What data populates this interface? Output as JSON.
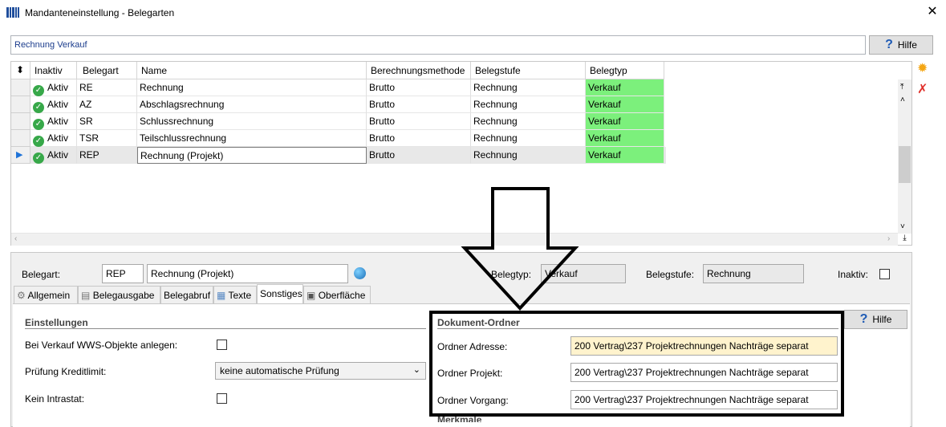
{
  "window": {
    "title": "Mandanteneinstellung - Belegarten",
    "close": "✕"
  },
  "filter": {
    "value": "Rechnung Verkauf"
  },
  "help": {
    "label": "Hilfe",
    "icon": "help-question-icon"
  },
  "grid": {
    "headers": [
      "Inaktiv",
      "Belegart",
      "Name",
      "Berechnungsmethode",
      "Belegstufe",
      "Belegtyp"
    ],
    "rows": [
      {
        "inaktiv": "Aktiv",
        "belegart": "RE",
        "name": "Rechnung",
        "methode": "Brutto",
        "stufe": "Rechnung",
        "typ": "Verkauf"
      },
      {
        "inaktiv": "Aktiv",
        "belegart": "AZ",
        "name": "Abschlagsrechnung",
        "methode": "Brutto",
        "stufe": "Rechnung",
        "typ": "Verkauf"
      },
      {
        "inaktiv": "Aktiv",
        "belegart": "SR",
        "name": "Schlussrechnung",
        "methode": "Brutto",
        "stufe": "Rechnung",
        "typ": "Verkauf"
      },
      {
        "inaktiv": "Aktiv",
        "belegart": "TSR",
        "name": "Teilschlussrechnung",
        "methode": "Brutto",
        "stufe": "Rechnung",
        "typ": "Verkauf"
      },
      {
        "inaktiv": "Aktiv",
        "belegart": "REP",
        "name": "Rechnung (Projekt)",
        "methode": "Brutto",
        "stufe": "Rechnung",
        "typ": "Verkauf"
      }
    ],
    "selected_row": 4
  },
  "detail": {
    "belegart_label": "Belegart:",
    "belegart_code": "REP",
    "belegart_name": "Rechnung (Projekt)",
    "belegtyp_label": "Belegtyp:",
    "belegtyp_value": "Verkauf",
    "belegstufe_label": "Belegstufe:",
    "belegstufe_value": "Rechnung",
    "inaktiv_label": "Inaktiv:"
  },
  "tabs": [
    "Allgemein",
    "Belegausgabe",
    "Belegabruf",
    "Texte",
    "Sonstiges",
    "Oberfläche"
  ],
  "active_tab": "Sonstiges",
  "einstellungen": {
    "title": "Einstellungen",
    "wws_label": "Bei Verkauf WWS-Objekte anlegen:",
    "kredit_label": "Prüfung Kreditlimit:",
    "kredit_value": "keine automatische Prüfung",
    "intrastat_label": "Kein Intrastat:"
  },
  "dokument_ordner": {
    "title": "Dokument-Ordner",
    "adresse_label": "Ordner Adresse:",
    "adresse_value": "200 Vertrag\\237 Projektrechnungen Nachträge separat",
    "projekt_label": "Ordner Projekt:",
    "projekt_value": "200 Vertrag\\237 Projektrechnungen Nachträge separat",
    "vorgang_label": "Ordner Vorgang:",
    "vorgang_value": "200 Vertrag\\237 Projektrechnungen Nachträge separat"
  },
  "merkmale": {
    "title": "Merkmale"
  },
  "colors": {
    "belegtyp_green": "#7cf07c",
    "accent_blue": "#1f5bb5",
    "highlight_yellow": "#fff3cd"
  }
}
